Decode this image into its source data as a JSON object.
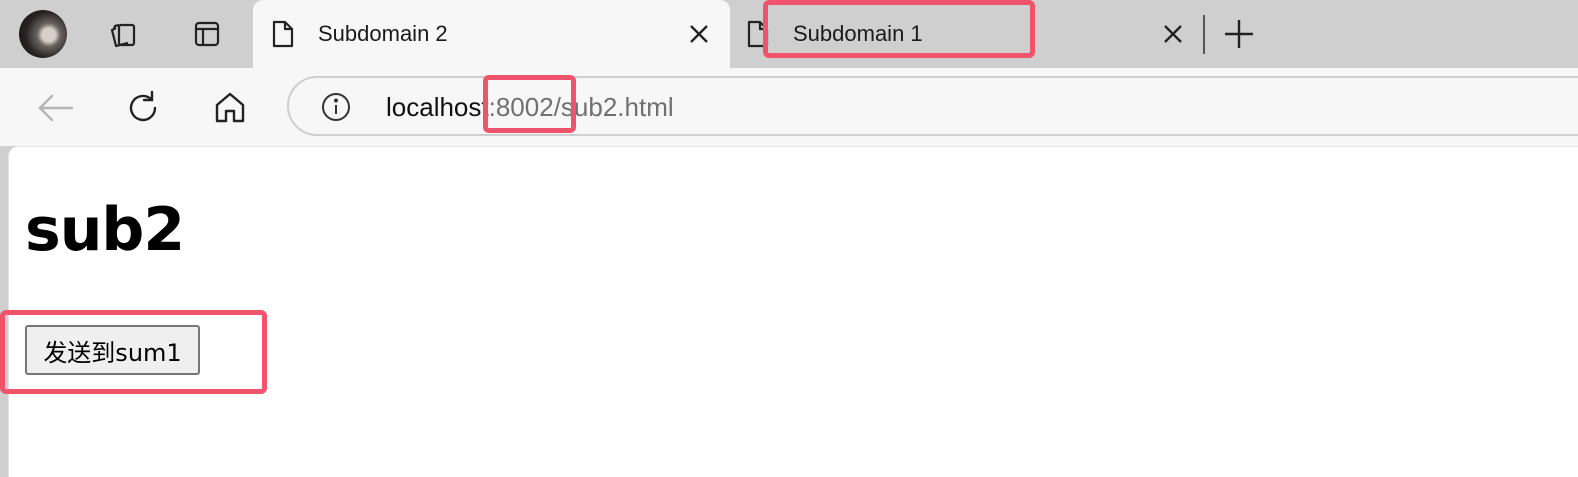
{
  "tabs": [
    {
      "title": "Subdomain 2",
      "active": true
    },
    {
      "title": "Subdomain 1",
      "active": false
    }
  ],
  "toolbar": {
    "url_host": "localhost",
    "url_rest": ":8002/sub2.html"
  },
  "page": {
    "heading": "sub2",
    "button_label": "发送到sum1"
  },
  "colors": {
    "highlight": "#f0546a",
    "tabstrip": "#cfcfcf",
    "toolbar": "#f7f7f7"
  },
  "icons": [
    "profile-avatar",
    "collections-icon",
    "vertical-tabs-icon",
    "page-icon",
    "close-icon",
    "new-tab-icon",
    "back-icon",
    "refresh-icon",
    "home-icon",
    "info-icon"
  ]
}
